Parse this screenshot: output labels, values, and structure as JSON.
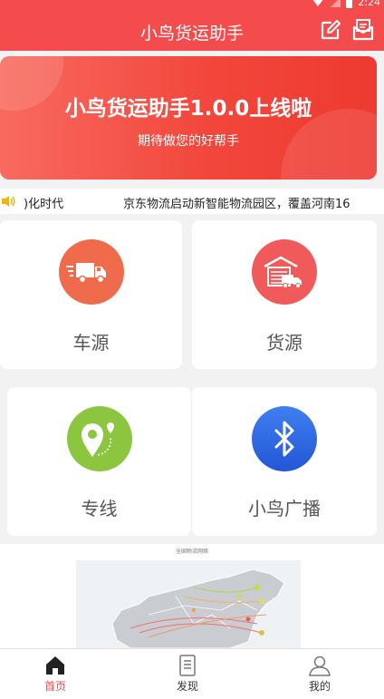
{
  "status_bar": {
    "time": "2:24"
  },
  "header": {
    "title": "小鸟货运助手",
    "icons": [
      "edit-icon",
      "mail-icon"
    ]
  },
  "banner": {
    "title": "小鸟货运助手1.0.0上线啦",
    "subtitle": "期待做您的好帮手"
  },
  "notice": {
    "text_left": ")化时代",
    "text_right": "京东物流启动新智能物流园区，覆盖河南16"
  },
  "grid": [
    {
      "label": "车源",
      "icon": "truck-icon",
      "color": "#ef6b4c"
    },
    {
      "label": "货源",
      "icon": "warehouse-truck-icon",
      "color": "#f05a5a"
    },
    {
      "label": "专线",
      "icon": "map-pin-icon",
      "color": "#8cc63f"
    },
    {
      "label": "小鸟广播",
      "icon": "bluetooth-icon",
      "color": "#2f6fe8"
    }
  ],
  "map": {
    "caption": "全国物流网络"
  },
  "tabs": [
    {
      "label": "首页",
      "icon": "home-icon",
      "active": true
    },
    {
      "label": "发现",
      "icon": "document-icon",
      "active": false
    },
    {
      "label": "我的",
      "icon": "person-icon",
      "active": false
    }
  ],
  "colors": {
    "primary": "#f44c4c",
    "active_tab": "#f44c4c"
  }
}
